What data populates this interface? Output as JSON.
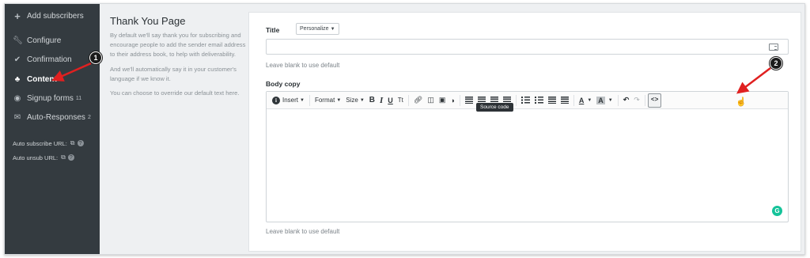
{
  "sidebar": {
    "add_label": "Add subscribers",
    "items": [
      {
        "label": "Configure",
        "icon": "wrench-icon"
      },
      {
        "label": "Confirmation",
        "icon": "check-icon"
      },
      {
        "label": "Content",
        "icon": "shapes-icon"
      },
      {
        "label": "Signup forms",
        "count": "11",
        "icon": "target-icon"
      },
      {
        "label": "Auto-Responses",
        "count": "2",
        "icon": "envelope-icon"
      }
    ],
    "auto_subscribe": "Auto subscribe URL:",
    "auto_unsub": "Auto unsub URL:"
  },
  "info": {
    "heading": "Thank You Page",
    "p1": "By default we'll say thank you for subscribing and encourage people to add the sender email address to their address book, to help with deliverability.",
    "p2": "And we'll automatically say it in your customer's language if we know it.",
    "p3": "You can choose to override our default text here."
  },
  "form": {
    "title_label": "Title",
    "personalize_label": "Personalize",
    "title_value": "",
    "title_hint": "Leave blank to use default",
    "body_label": "Body copy",
    "body_hint": "Leave blank to use default"
  },
  "toolbar": {
    "insert": "Insert",
    "format": "Format",
    "size": "Size",
    "bold": "B",
    "italic": "I",
    "underline": "U",
    "tt": "Tt",
    "text_color": "A",
    "bg_color": "A",
    "source": "<>",
    "tooltip": "Source code"
  },
  "callouts": {
    "one": "1",
    "two": "2"
  },
  "colors": {
    "sidebar_bg": "#343b40",
    "arrow": "#e02020",
    "grammarly": "#15c39a"
  }
}
